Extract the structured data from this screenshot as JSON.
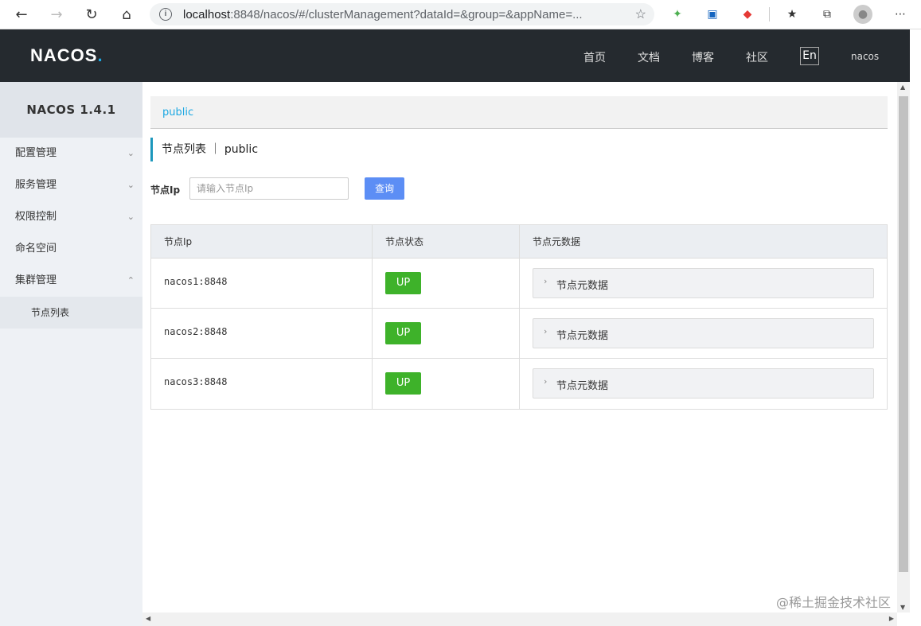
{
  "browser": {
    "url_host": "localhost",
    "url_rest": ":8848/nacos/#/clusterManagement?dataId=&group=&appName=..."
  },
  "header": {
    "logo_text": "NACOS",
    "logo_dot": ".",
    "nav": [
      "首页",
      "文档",
      "博客",
      "社区"
    ],
    "lang": "En",
    "user": "nacos"
  },
  "sidebar": {
    "title": "NACOS 1.4.1",
    "items": [
      {
        "label": "配置管理",
        "expanded": false
      },
      {
        "label": "服务管理",
        "expanded": false
      },
      {
        "label": "权限控制",
        "expanded": false
      },
      {
        "label": "命名空间"
      },
      {
        "label": "集群管理",
        "expanded": true
      }
    ],
    "subitems": [
      {
        "label": "节点列表"
      }
    ]
  },
  "main": {
    "namespace": "public",
    "title": "节点列表 ｜ public",
    "search_label": "节点Ip",
    "search_placeholder": "请输入节点Ip",
    "search_button": "查询",
    "columns": [
      "节点Ip",
      "节点状态",
      "节点元数据"
    ],
    "rows": [
      {
        "ip": "nacos1:8848",
        "status": "UP",
        "meta": "节点元数据"
      },
      {
        "ip": "nacos2:8848",
        "status": "UP",
        "meta": "节点元数据"
      },
      {
        "ip": "nacos3:8848",
        "status": "UP",
        "meta": "节点元数据"
      }
    ]
  },
  "watermark": "@稀土掘金技术社区",
  "colors": {
    "header_bg": "#252a2f",
    "accent": "#1ca8e3",
    "button": "#5c8ef5",
    "status_up": "#3eb22a"
  }
}
